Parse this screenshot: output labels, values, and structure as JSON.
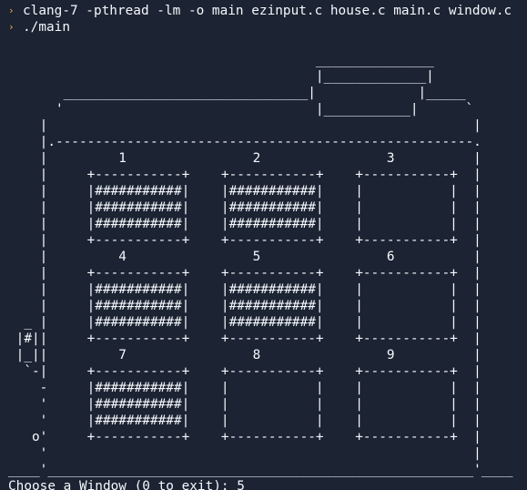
{
  "terminal": {
    "prompt_symbol": "›",
    "history": [
      {
        "command": "clang-7 -pthread -lm -o main ezinput.c house.c main.c window.c"
      },
      {
        "command": "./main"
      }
    ],
    "house_art": "\n                                       _______________\n                                       |_____________|\n       _______________________________|             |_____\n      '                                |___________|      `\n    |                                                      |\n    |.-----------------------------------------------------.\n    |         1                2                3          |\n    |     +-----------+    +-----------+    +-----------+  |\n    |     |###########|    |###########|    |           |  |\n    |     |###########|    |###########|    |           |  |\n    |     |###########|    |###########|    |           |  |\n    |     +-----------+    +-----------+    +-----------+  |\n    |         4                5                6          |\n    |     +-----------+    +-----------+    +-----------+  |\n    |     |###########|    |###########|    |           |  |\n    |     |###########|    |###########|    |           |  |\n  _ |     |###########|    |###########|    |           |  |\n |#||     +-----------+    +-----------+    +-----------+  |\n |_||         7                8                9          |\n  `-|     +-----------+    +-----------+    +-----------+  |\n    -     |###########|    |           |    |           |  |\n    '     |###########|    |           |    |           |  |\n    '     |###########|    |           |    |           |  |\n   o'     +-----------+    +-----------+    +-----------+  |\n    '                                                      |\n____'______________________________________________________'____",
    "input_prompt": "Choose a Window (0 to exit): ",
    "input_value": "5"
  },
  "colors": {
    "background": "#1c2333",
    "text": "#f5f9fc",
    "prompt": "#e8b04b"
  }
}
